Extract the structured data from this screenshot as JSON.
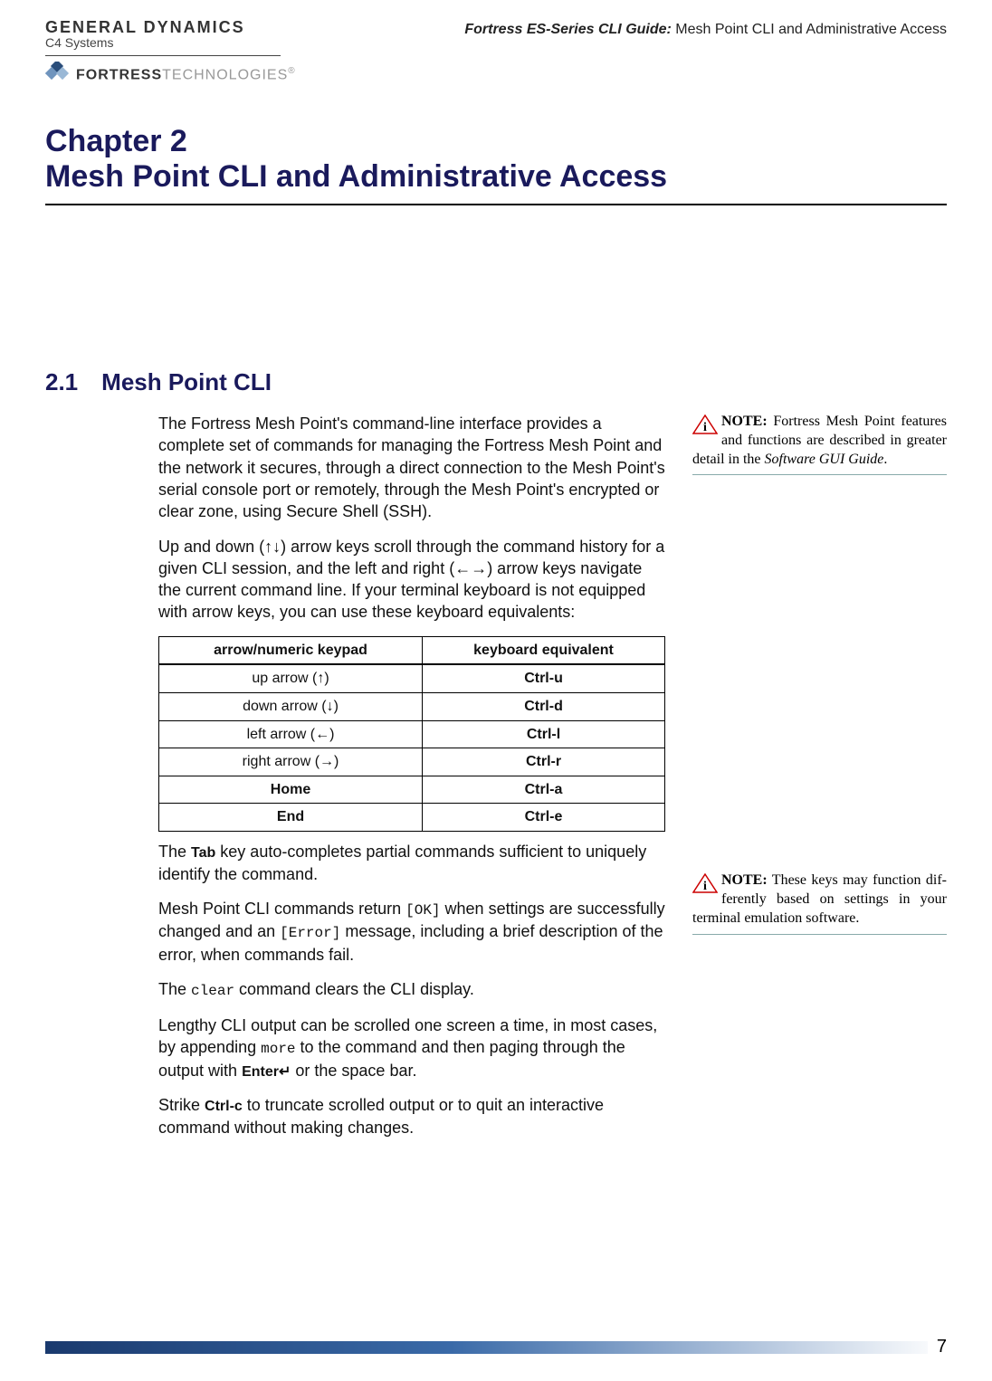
{
  "header": {
    "gd_line1": "GENERAL DYNAMICS",
    "gd_line2": "C4 Systems",
    "guide_prefix": "Fortress ES-Series CLI Guide:",
    "guide_suffix": " Mesh Point CLI and Administrative Access",
    "fortress_bold": "FORTRESS",
    "fortress_light": "TECHNOLOGIES",
    "fortress_reg": "®"
  },
  "chapter": {
    "label": "Chapter 2",
    "title": "Mesh Point CLI and Administrative Access"
  },
  "section": {
    "num": "2.1",
    "title": "Mesh Point CLI"
  },
  "body": {
    "p1": "The Fortress Mesh Point's command-line interface provides a complete set of commands for managing the Fortress Mesh Point and the network it secures, through a direct connection to the Mesh Point's serial console port or remotely, through the Mesh Point's encrypted or clear zone, using Secure Shell (SSH).",
    "p2": "Up and down (↑↓) arrow keys scroll through the command history for a given CLI session, and the left and right (←→) arrow keys navigate the current command line. If your terminal keyboard is not equipped with arrow keys, you can use these keyboard equivalents:",
    "p3_pre": "The ",
    "p3_tab": "Tab",
    "p3_post": " key auto-completes partial commands sufficient to uniquely identify the command.",
    "p4_a": "Mesh Point CLI commands return ",
    "p4_ok": "[OK]",
    "p4_b": " when settings are successfully changed and an ",
    "p4_err": "[Error]",
    "p4_c": " message, including a brief description of the error, when commands fail.",
    "p5_a": "The ",
    "p5_clear": "clear",
    "p5_b": " command clears the CLI display.",
    "p6_a": "Lengthy CLI output can be scrolled one screen a time, in most cases, by appending ",
    "p6_more": "more",
    "p6_b": " to the command and then paging through the output with ",
    "p6_enter": "Enter↵",
    "p6_c": " or the space bar.",
    "p7_a": "Strike ",
    "p7_ctrlc": "Ctrl-c",
    "p7_b": " to truncate scrolled output or to quit an interactive command without making changes."
  },
  "table": {
    "h1": "arrow/numeric keypad",
    "h2": "keyboard equivalent",
    "rows": [
      {
        "k": "up arrow (↑)",
        "v": "Ctrl-u",
        "kbold": false
      },
      {
        "k": "down arrow (↓)",
        "v": "Ctrl-d",
        "kbold": false
      },
      {
        "k": "left arrow (←)",
        "v": "Ctrl-l",
        "kbold": false
      },
      {
        "k": "right arrow (→)",
        "v": "Ctrl-r",
        "kbold": false
      },
      {
        "k": "Home",
        "v": "Ctrl-a",
        "kbold": true
      },
      {
        "k": "End",
        "v": "Ctrl-e",
        "kbold": true
      }
    ]
  },
  "notes": {
    "n1_label": "NOTE:",
    "n1_text_a": " Fortress Mesh Point fea­tures and functions are described in greater detail in the ",
    "n1_ital": "Software GUI Guide",
    "n1_text_b": ".",
    "n2_label": "NOTE:",
    "n2_text": " These keys may function dif­ferently based on set­tings in your terminal emulation software."
  },
  "page_number": "7"
}
